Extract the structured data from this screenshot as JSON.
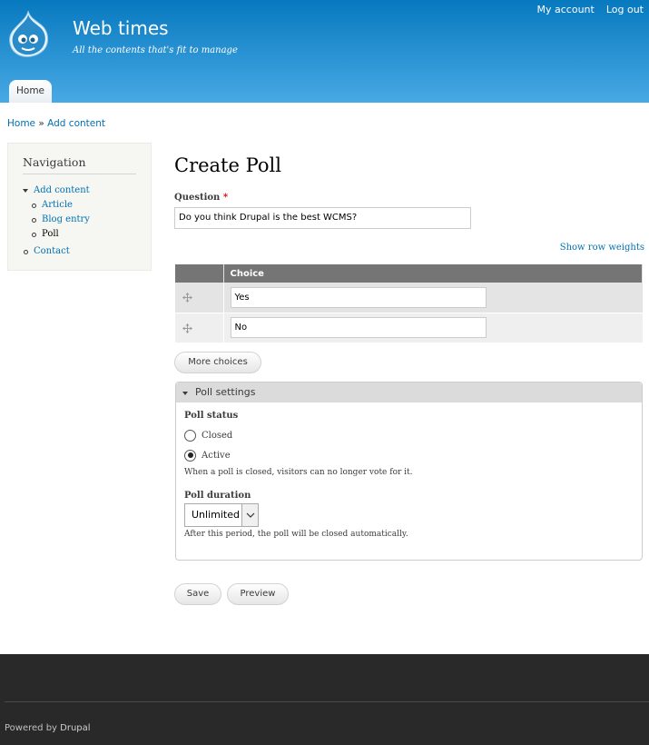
{
  "header": {
    "site_name": "Web times",
    "slogan": "All the contents that's fit to manage",
    "secondary_menu": [
      "My account",
      "Log out"
    ],
    "primary_tab": "Home"
  },
  "breadcrumb": {
    "home": "Home",
    "separator": "»",
    "current": "Add content"
  },
  "sidebar": {
    "title": "Navigation",
    "items": [
      {
        "label": "Add content",
        "icon": "triangle-down-bullet"
      },
      {
        "label": "Article"
      },
      {
        "label": "Blog entry"
      },
      {
        "label": "Poll",
        "active": true
      },
      {
        "label": "Contact"
      }
    ]
  },
  "main": {
    "title": "Create Poll",
    "question_label": "Question",
    "required_mark": "*",
    "question_value": "Do you think Drupal is the best WCMS?",
    "show_row_weights": "Show row weights",
    "choice_header": "Choice",
    "choices": [
      "Yes",
      "No"
    ],
    "more_choices": "More choices",
    "poll_settings": {
      "legend": "Poll settings",
      "status_label": "Poll status",
      "options": [
        "Closed",
        "Active"
      ],
      "selected": "Active",
      "status_description": "When a poll is closed, visitors can no longer vote for it.",
      "duration_label": "Poll duration",
      "duration_value": "Unlimited",
      "duration_description": "After this period, the poll will be closed automatically."
    },
    "save": "Save",
    "preview": "Preview"
  },
  "footer": {
    "powered_by": "Powered by",
    "drupal": "Drupal"
  },
  "colors": {
    "header_top": "#0779bf",
    "header_bottom": "#48a9e4",
    "link": "#0071b3",
    "footer": "#292929"
  }
}
